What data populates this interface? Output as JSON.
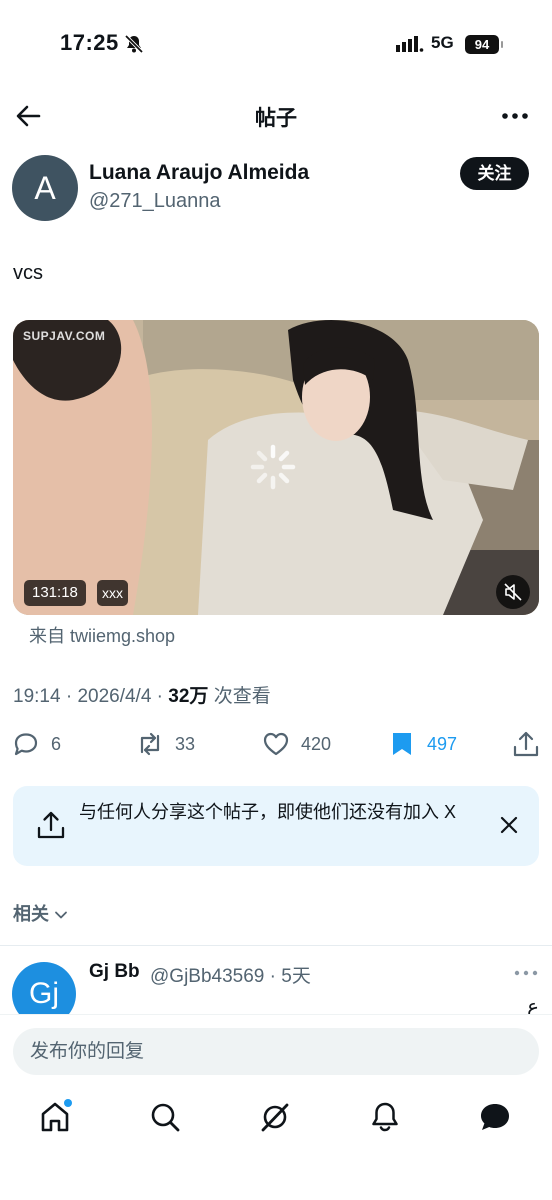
{
  "status_bar": {
    "time": "17:25",
    "network": "5G",
    "battery": "94"
  },
  "header": {
    "title": "帖子"
  },
  "author": {
    "avatar_letter": "A",
    "name": "Luana Araujo Almeida",
    "handle": "@271_Luanna",
    "follow_label": "关注"
  },
  "post": {
    "text": "vcs",
    "watermark": "SUPJAV.COM",
    "duration": "131:18",
    "quality": "xxx",
    "source_prefix": "来自 ",
    "source_link": "twiiemg.shop",
    "time": "19:14",
    "date": "2026/4/4",
    "views": "32万",
    "views_label": "次查看"
  },
  "actions": {
    "replies": "6",
    "reposts": "33",
    "likes": "420",
    "bookmarks": "497"
  },
  "share_banner": {
    "text": "与任何人分享这个帖子，即使他们还没有加入 X"
  },
  "related": {
    "label": "相关"
  },
  "reply": {
    "avatar_letter": "Gj",
    "name": "Gj Bb",
    "handle": "@GjBb43569",
    "age": "5天",
    "text": "ع"
  },
  "composer": {
    "placeholder": "发布你的回复"
  },
  "colors": {
    "accent": "#1d9bf0",
    "text": "#0f1419",
    "secondary": "#536471",
    "banner_bg": "#e8f5fd"
  },
  "icons": [
    "back-arrow-icon",
    "more-icon",
    "reply-icon",
    "repost-icon",
    "like-icon",
    "bookmark-icon",
    "share-icon",
    "close-icon",
    "home-icon",
    "search-icon",
    "grok-icon",
    "notifications-icon",
    "messages-icon"
  ]
}
